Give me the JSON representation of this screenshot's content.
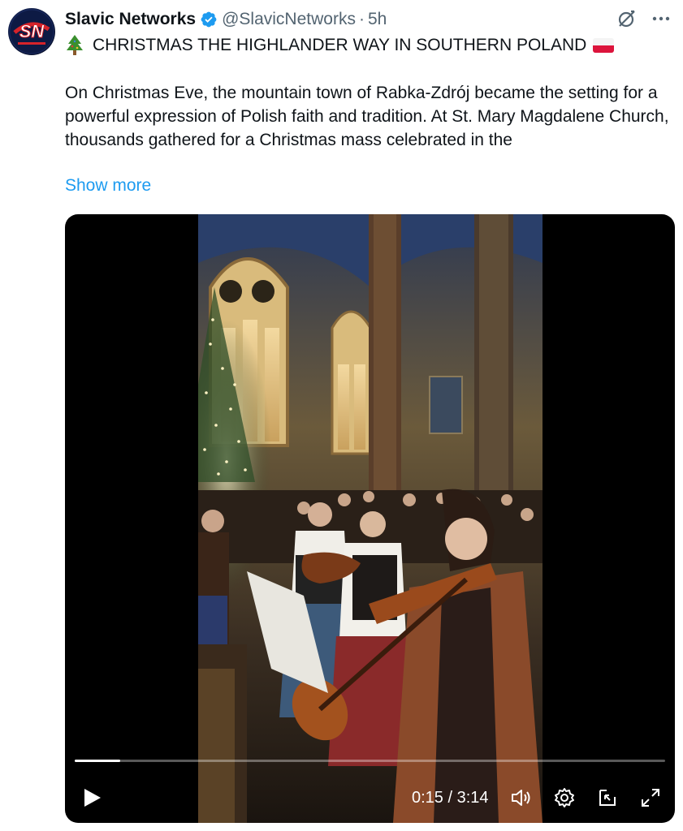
{
  "post": {
    "display_name": "Slavic Networks",
    "handle": "@SlavicNetworks",
    "separator": "·",
    "time": "5h",
    "headline": "CHRISTMAS THE HIGHLANDER WAY IN SOUTHERN POLAND",
    "body": "On Christmas Eve, the mountain town of Rabka-Zdrój became the setting for a powerful expression of Polish faith and tradition. At St. Mary Magdalene Church, thousands gathered for a Christmas mass celebrated in the",
    "show_more": "Show more",
    "avatar_text": "SN"
  },
  "icons": {
    "verified": "verified-badge-icon",
    "grok": "grok-icon",
    "more": "more-icon",
    "tree": "christmas-tree-emoji",
    "flag": "poland-flag-emoji"
  },
  "video": {
    "time_display": "0:15 / 3:14",
    "progress": 0.077
  },
  "colors": {
    "link": "#1d9bf0",
    "secondary_text": "#536471",
    "verified": "#1d9bf0"
  }
}
